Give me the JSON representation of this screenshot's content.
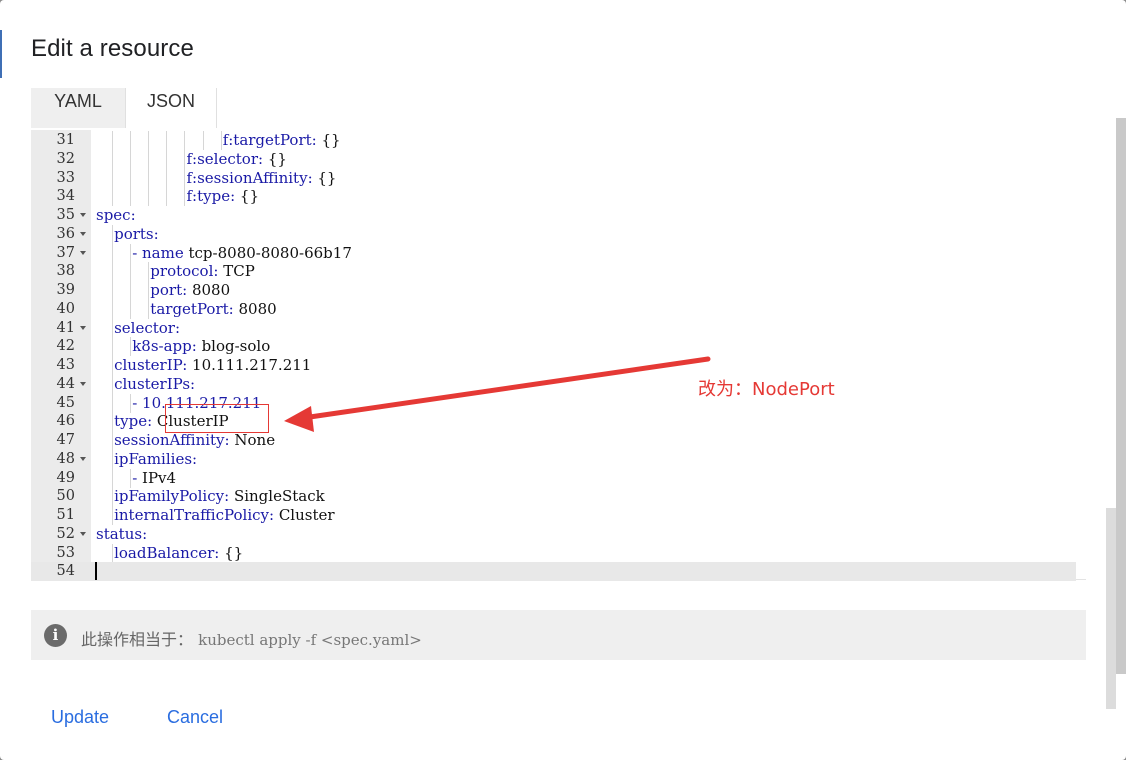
{
  "dialog": {
    "title": "Edit a resource",
    "tabs": [
      {
        "label": "YAML"
      },
      {
        "label": "JSON"
      }
    ]
  },
  "editor": {
    "lines": [
      {
        "num": "31",
        "fold": false,
        "key": "f:targetPort",
        "val": " {}"
      },
      {
        "num": "32",
        "fold": false,
        "key": "f:selector",
        "val": " {}"
      },
      {
        "num": "33",
        "fold": false,
        "key": "f:sessionAffinity",
        "val": " {}"
      },
      {
        "num": "34",
        "fold": false,
        "key": "f:type",
        "val": " {}"
      },
      {
        "num": "35",
        "fold": true,
        "key": "spec",
        "val": ""
      },
      {
        "num": "36",
        "fold": true,
        "key": "ports",
        "val": ""
      },
      {
        "num": "37",
        "fold": true,
        "key": "- name",
        "val": " tcp-8080-8080-66b17"
      },
      {
        "num": "38",
        "fold": false,
        "key": "protocol",
        "val": " TCP"
      },
      {
        "num": "39",
        "fold": false,
        "key": "port",
        "val": " 8080"
      },
      {
        "num": "40",
        "fold": false,
        "key": "targetPort",
        "val": " 8080"
      },
      {
        "num": "41",
        "fold": true,
        "key": "selector",
        "val": ""
      },
      {
        "num": "42",
        "fold": false,
        "key": "k8s-app",
        "val": " blog-solo"
      },
      {
        "num": "43",
        "fold": false,
        "key": "clusterIP",
        "val": " 10.111.217.211"
      },
      {
        "num": "44",
        "fold": true,
        "key": "clusterIPs",
        "val": ""
      },
      {
        "num": "45",
        "fold": false,
        "key": "- 10.111.217.211",
        "val": ""
      },
      {
        "num": "46",
        "fold": false,
        "key": "type",
        "val": " ClusterIP"
      },
      {
        "num": "47",
        "fold": false,
        "key": "sessionAffinity",
        "val": " None"
      },
      {
        "num": "48",
        "fold": true,
        "key": "ipFamilies",
        "val": ""
      },
      {
        "num": "49",
        "fold": false,
        "key": "- ",
        "val": "IPv4"
      },
      {
        "num": "50",
        "fold": false,
        "key": "ipFamilyPolicy",
        "val": " SingleStack"
      },
      {
        "num": "51",
        "fold": false,
        "key": "internalTrafficPolicy",
        "val": " Cluster"
      },
      {
        "num": "52",
        "fold": true,
        "key": "status",
        "val": ""
      },
      {
        "num": "53",
        "fold": false,
        "key": "loadBalancer",
        "val": " {}"
      },
      {
        "num": "54",
        "fold": false,
        "key": "",
        "val": ""
      }
    ]
  },
  "info": {
    "label": "此操作相当于：",
    "command": "kubectl apply -f <spec.yaml>"
  },
  "buttons": {
    "update": "Update",
    "cancel": "Cancel"
  },
  "annotation": {
    "text": "改为：NodePort",
    "color": "#e53935"
  },
  "colors": {
    "key": "#1a1aa6",
    "accent": "#2a6de0"
  }
}
